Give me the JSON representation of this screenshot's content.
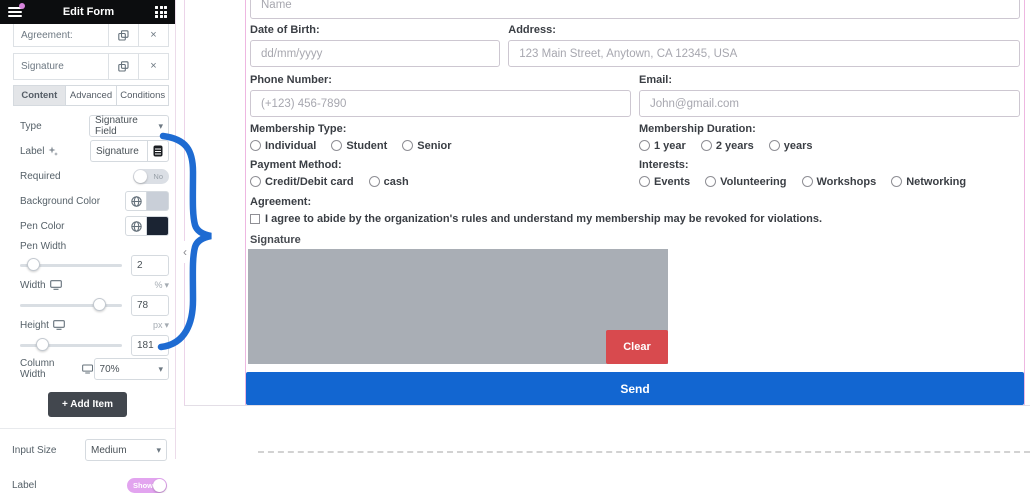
{
  "panel": {
    "title": "Edit Form",
    "repeater_items": [
      {
        "label": "Agreement:"
      },
      {
        "label": "Signature"
      }
    ],
    "tabs": [
      {
        "label": "Content"
      },
      {
        "label": "Advanced"
      },
      {
        "label": "Conditions"
      }
    ],
    "controls": {
      "type": {
        "label": "Type",
        "value": "Signature Field"
      },
      "field_label": {
        "label": "Label",
        "value": "Signature"
      },
      "required": {
        "label": "Required",
        "state": "No"
      },
      "background_color": {
        "label": "Background Color",
        "swatch": "#c9cfd8"
      },
      "pen_color": {
        "label": "Pen Color",
        "swatch": "#1b2433"
      },
      "pen_width": {
        "label": "Pen Width",
        "value": "2"
      },
      "width": {
        "label": "Width",
        "unit": "%",
        "value": "78"
      },
      "height": {
        "label": "Height",
        "unit": "px",
        "value": "181"
      },
      "column_width": {
        "label": "Column Width",
        "value": "70%"
      }
    },
    "add_item_label": "+  Add Item",
    "input_size": {
      "label": "Input Size",
      "value": "Medium"
    },
    "label_toggle": {
      "label": "Label",
      "state": "Show"
    }
  },
  "canvas": {
    "form": {
      "name": {
        "placeholder": "Name"
      },
      "dob": {
        "label": "Date of Birth:",
        "placeholder": "dd/mm/yyyy"
      },
      "address": {
        "label": "Address:",
        "placeholder": "123 Main Street, Anytown, CA 12345, USA"
      },
      "phone": {
        "label": "Phone Number:",
        "placeholder": "(+123) 456-7890"
      },
      "email": {
        "label": "Email:",
        "placeholder": "John@gmail.com"
      },
      "membership_type": {
        "label": "Membership Type:",
        "options": [
          "Individual",
          "Student",
          "Senior"
        ]
      },
      "membership_duration": {
        "label": "Membership Duration:",
        "options": [
          "1 year",
          "2 years",
          "years"
        ]
      },
      "payment_method": {
        "label": "Payment Method:",
        "options": [
          "Credit/Debit card",
          "cash"
        ]
      },
      "interests": {
        "label": "Interests:",
        "options": [
          "Events",
          "Volunteering",
          "Workshops",
          "Networking"
        ]
      },
      "agreement": {
        "label": "Agreement:",
        "text": "I agree to abide by the organization's rules and understand my membership may be revoked for violations."
      },
      "signature": {
        "label": "Signature",
        "clear_label": "Clear"
      },
      "send_label": "Send"
    }
  },
  "icons": {
    "hamburger": "menu bars",
    "apps_grid": "3x3 grid",
    "duplicate": "two overlapping squares",
    "close": "×",
    "ai_stars": "sparkle stars",
    "dynamic_tags": "database stack",
    "globe": "globe",
    "responsive_monitor": "monitor",
    "dropdown_caret": "▾",
    "collapse_panel": "‹"
  },
  "colors": {
    "header_bg": "#0c0d0f",
    "accent_blue": "#1266d1",
    "brace_blue": "#1e6bd2",
    "clear_red": "#d84a4e",
    "signature_pad": "#a9aeb5",
    "show_toggle_pink": "#e2a4ef",
    "selection_border_pink": "#eeb7e1"
  }
}
